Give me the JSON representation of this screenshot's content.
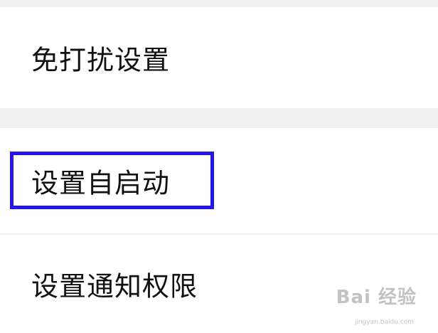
{
  "settings": {
    "items": [
      {
        "label": "免打扰设置"
      },
      {
        "label": "设置自启动",
        "highlighted": true
      },
      {
        "label": "设置通知权限"
      }
    ]
  },
  "colors": {
    "highlight_border": "#2416e6",
    "section_gap": "#f0f0f0",
    "text": "#111111"
  },
  "watermark": {
    "brand": "Bai 经验",
    "url": "jingyan.baidu.com"
  }
}
